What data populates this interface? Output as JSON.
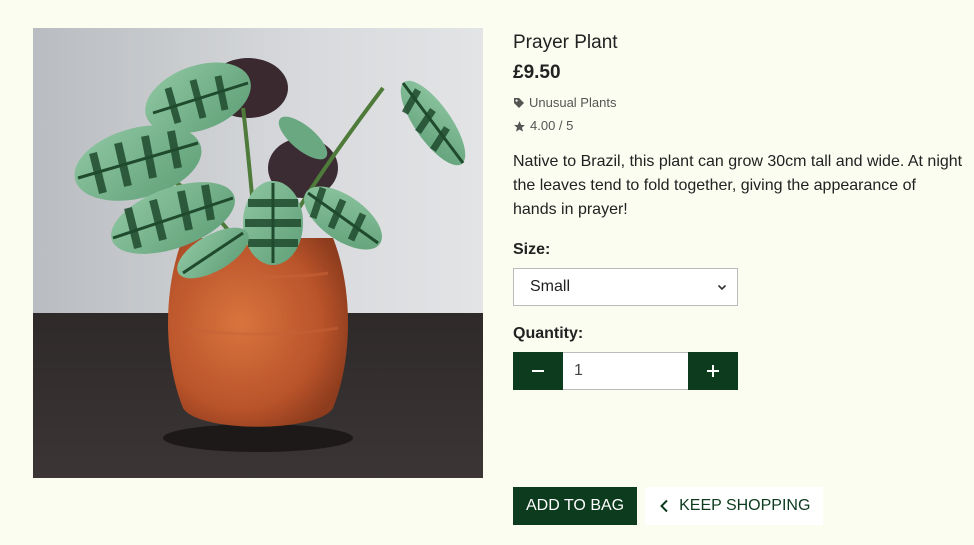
{
  "product": {
    "name": "Prayer Plant",
    "price": "£9.50",
    "category": "Unusual Plants",
    "rating": "4.00 / 5",
    "description": "Native to Brazil, this plant can grow 30cm tall and wide. At night the leaves tend to fold together, giving the appearance of hands in prayer!",
    "image_icon": "prayer-plant-photo"
  },
  "form": {
    "size_label": "Size:",
    "size_selected": "Small",
    "quantity_label": "Quantity:",
    "quantity_value": "1",
    "decrement_icon": "minus-icon",
    "increment_icon": "plus-icon"
  },
  "actions": {
    "add_to_bag": "ADD TO BAG",
    "keep_shopping": "KEEP SHOPPING"
  },
  "colors": {
    "background": "#fbfdf1",
    "accent": "#0c3b1d"
  }
}
